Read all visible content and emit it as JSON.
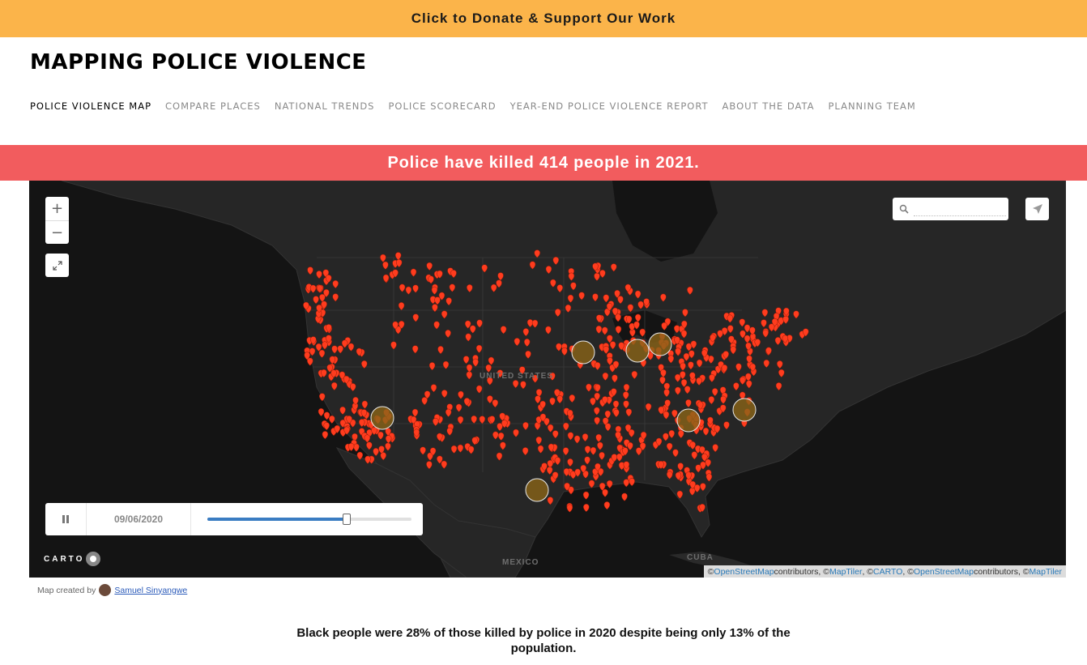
{
  "donate": {
    "label": "Click to Donate & Support Our Work"
  },
  "header": {
    "title": "MAPPING POLICE VIOLENCE"
  },
  "nav": {
    "items": [
      {
        "label": "POLICE VIOLENCE MAP",
        "active": true
      },
      {
        "label": "COMPARE PLACES",
        "active": false
      },
      {
        "label": "NATIONAL TRENDS",
        "active": false
      },
      {
        "label": "POLICE SCORECARD",
        "active": false
      },
      {
        "label": "YEAR-END POLICE VIOLENCE REPORT",
        "active": false
      },
      {
        "label": "ABOUT THE DATA",
        "active": false
      },
      {
        "label": "PLANNING TEAM",
        "active": false
      }
    ]
  },
  "banner": {
    "text": "Police have killed 414 people in 2021."
  },
  "map": {
    "controls": {
      "zoom_in": "+",
      "zoom_out": "−",
      "fullscreen_icon": "expand-icon",
      "locate_icon": "navigation-arrow-icon"
    },
    "search": {
      "placeholder": ""
    },
    "labels": {
      "country_us": "UNITED STATES",
      "country_mx": "MEXICO",
      "country_cu": "CUBA"
    },
    "timeslider": {
      "date": "09/06/2020",
      "progress": 0.68
    },
    "carto_logo": "CARTO",
    "attribution": {
      "prefix": "© ",
      "link1": "OpenStreetMap",
      "text1": " contributors, © ",
      "link2": "MapTiler",
      "text2": ", © ",
      "link3": "CARTO",
      "text3": ", © ",
      "link4": "OpenStreetMap",
      "text4": " contributors, © ",
      "link5": "MapTiler"
    },
    "marker_color": "#ff3c1e"
  },
  "credit": {
    "prefix": "Map created by",
    "author": "Samuel Sinyangwe"
  },
  "stat": {
    "text": "Black people were 28% of those killed by police in 2020 despite being only 13% of the population."
  }
}
